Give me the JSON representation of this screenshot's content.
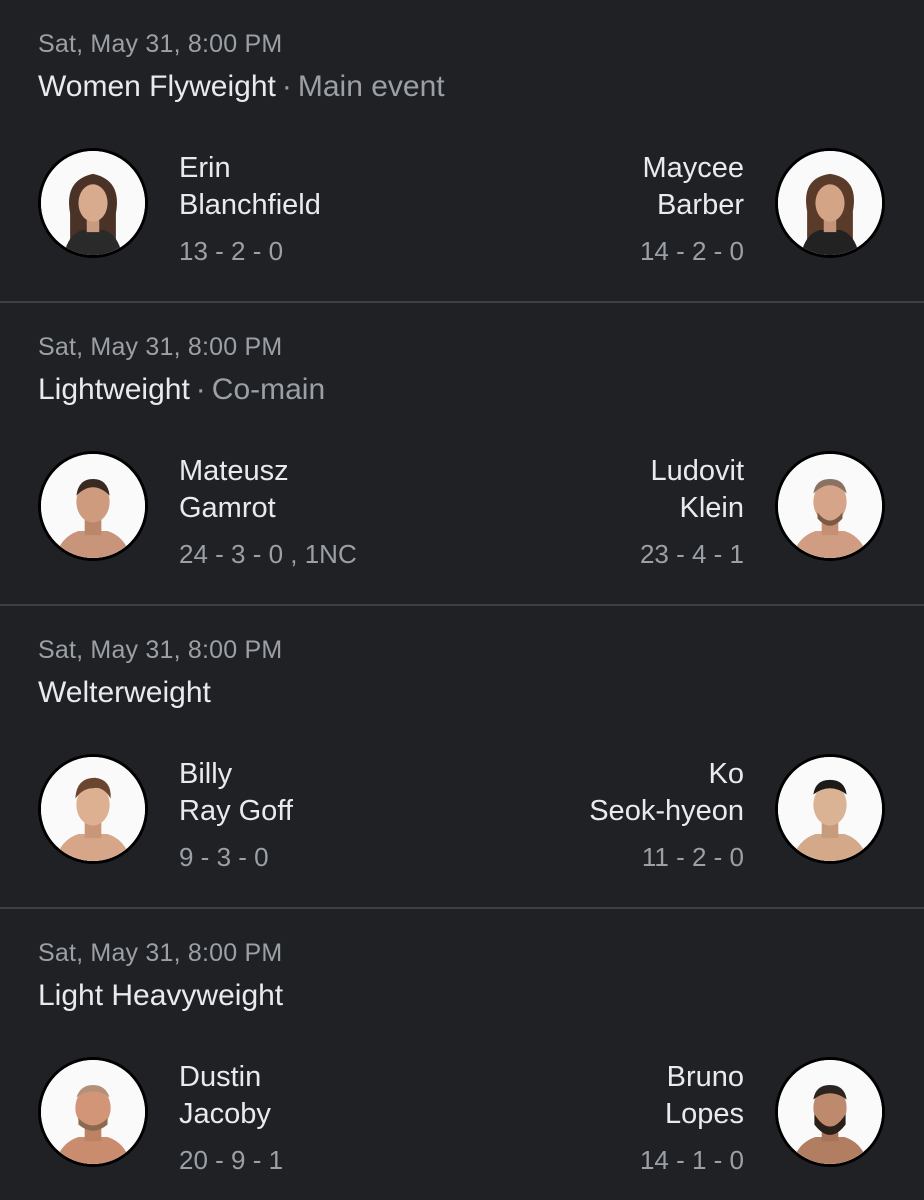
{
  "fights": [
    {
      "date": "Sat, May 31, 8:00 PM",
      "division": "Women Flyweight",
      "tag": "Main event",
      "fighter1": {
        "first": "Erin",
        "last": "Blanchfield",
        "record": "13 - 2 - 0",
        "avatar_icon": "female-fighter-portrait"
      },
      "fighter2": {
        "first": "Maycee",
        "last": "Barber",
        "record": "14 - 2 - 0",
        "avatar_icon": "female-fighter-portrait"
      }
    },
    {
      "date": "Sat, May 31, 8:00 PM",
      "division": "Lightweight",
      "tag": "Co-main",
      "fighter1": {
        "first": "Mateusz",
        "last": "Gamrot",
        "record": "24 - 3 - 0 , 1NC",
        "avatar_icon": "male-fighter-portrait"
      },
      "fighter2": {
        "first": "Ludovit",
        "last": "Klein",
        "record": "23 - 4 - 1",
        "avatar_icon": "male-fighter-portrait"
      }
    },
    {
      "date": "Sat, May 31, 8:00 PM",
      "division": "Welterweight",
      "tag": "",
      "fighter1": {
        "first": "Billy",
        "last": "Ray Goff",
        "record": "9 - 3 - 0",
        "avatar_icon": "male-fighter-portrait"
      },
      "fighter2": {
        "first": "Ko",
        "last": "Seok-hyeon",
        "record": "11 - 2 - 0",
        "avatar_icon": "male-fighter-portrait"
      }
    },
    {
      "date": "Sat, May 31, 8:00 PM",
      "division": "Light Heavyweight",
      "tag": "",
      "fighter1": {
        "first": "Dustin",
        "last": "Jacoby",
        "record": "20 - 9 - 1",
        "avatar_icon": "male-fighter-portrait"
      },
      "fighter2": {
        "first": "Bruno",
        "last": "Lopes",
        "record": "14 - 1 - 0",
        "avatar_icon": "male-fighter-portrait"
      }
    }
  ],
  "colors": {
    "background": "#202124",
    "primary_text": "#e8eaed",
    "secondary_text": "#9aa0a6",
    "divider": "#3c4043"
  }
}
